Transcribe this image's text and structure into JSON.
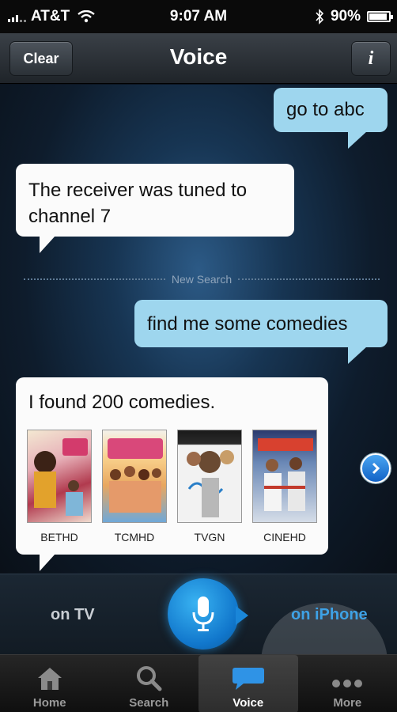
{
  "status_bar": {
    "carrier": "AT&T",
    "time": "9:07 AM",
    "battery": "90%",
    "battery_level": 0.9
  },
  "nav": {
    "title": "Voice",
    "clear_label": "Clear",
    "info_label": "i"
  },
  "conversation": {
    "msg1": "go to abc",
    "msg2": "The receiver was tuned to channel 7",
    "divider": "New Search",
    "msg3": "find me some comedies",
    "msg4": "I found 200 comedies.",
    "channels": [
      "BETHD",
      "TCMHD",
      "TVGN",
      "CINEHD"
    ]
  },
  "control": {
    "on_tv": "on TV",
    "on_iphone": "on iPhone"
  },
  "tabs": [
    {
      "label": "Home",
      "icon": "home-icon"
    },
    {
      "label": "Search",
      "icon": "search-icon"
    },
    {
      "label": "Voice",
      "icon": "voice-icon"
    },
    {
      "label": "More",
      "icon": "more-icon"
    }
  ],
  "colors": {
    "user_bubble": "#9ed6ee",
    "system_bubble": "#fbfbfb",
    "accent": "#3ea2e6"
  }
}
